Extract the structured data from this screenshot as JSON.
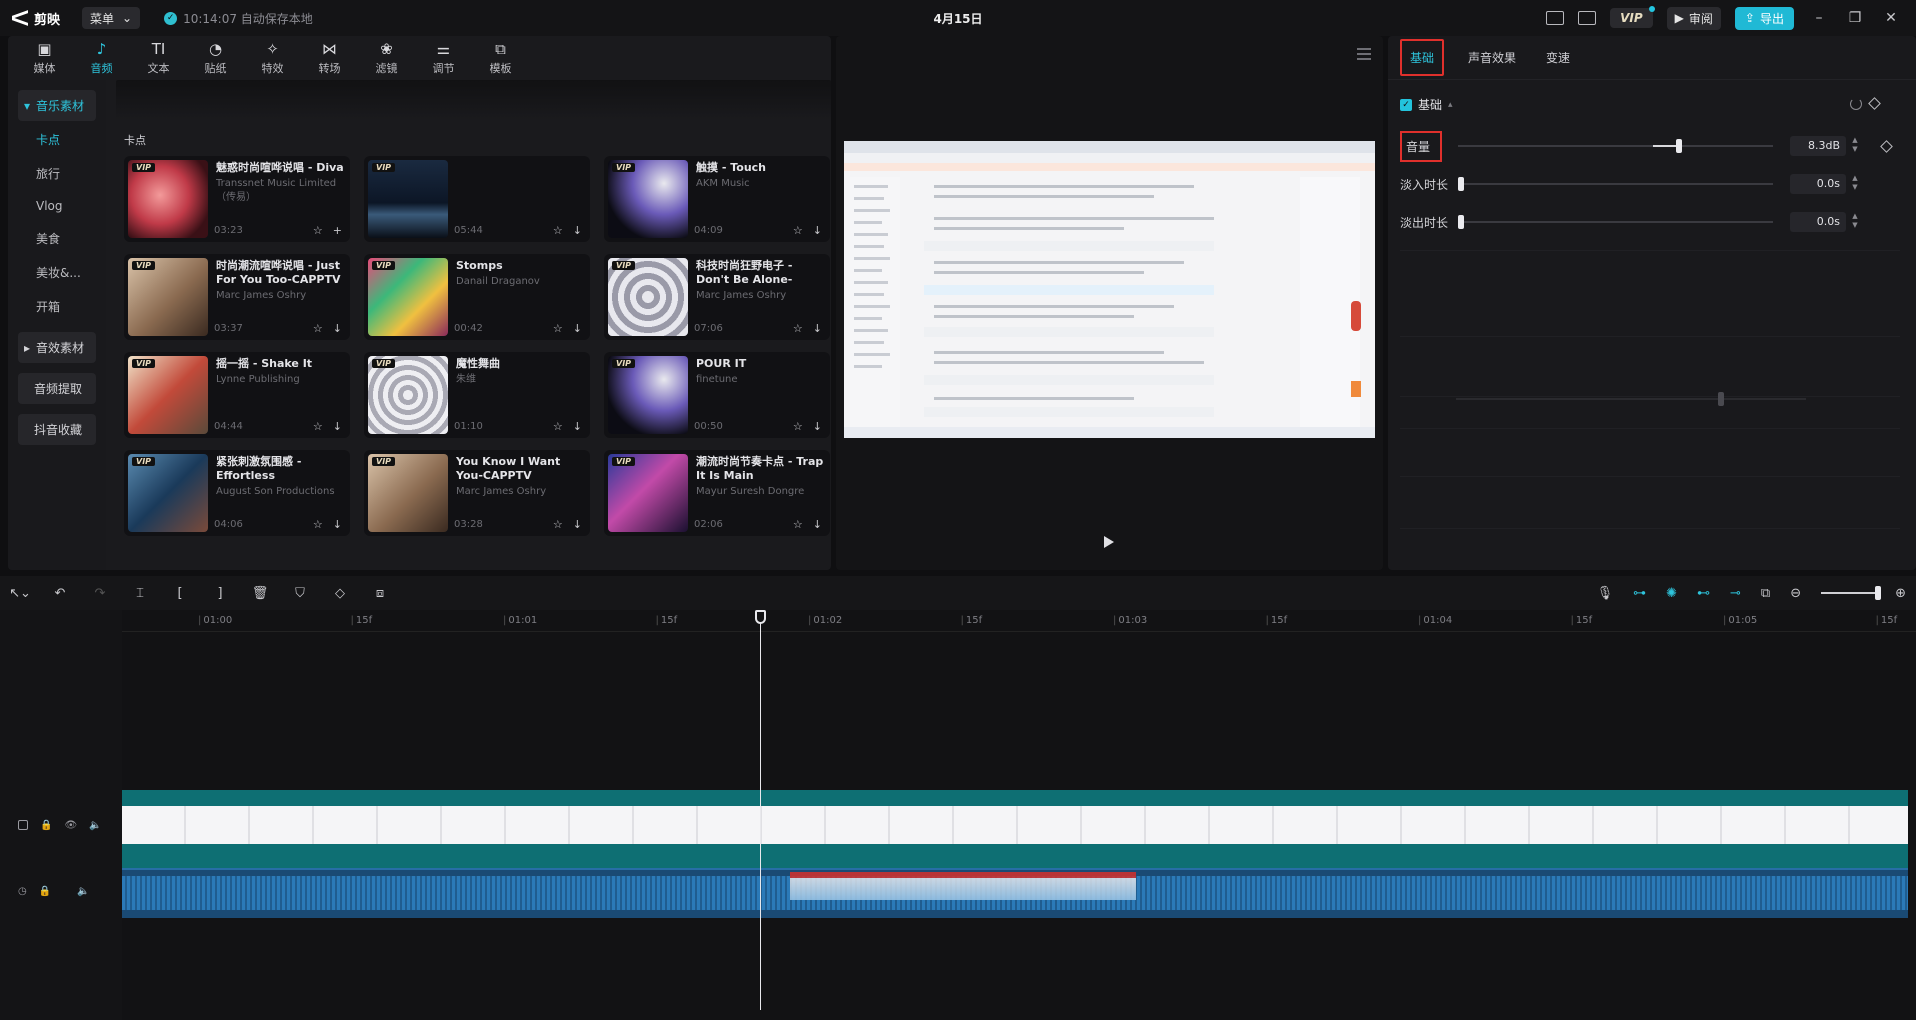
{
  "titlebar": {
    "app_name": "剪映",
    "menu_label": "菜单",
    "save_status": "10:14:07 自动保存本地",
    "project_title": "4月15日",
    "vip_label": "VIP",
    "review_label": "审阅",
    "export_label": "导出"
  },
  "toolbar": {
    "tabs": [
      {
        "label": "媒体",
        "icon": "media-icon",
        "glyph": "▣"
      },
      {
        "label": "音频",
        "icon": "audio-icon",
        "glyph": "♪"
      },
      {
        "label": "文本",
        "icon": "text-icon",
        "glyph": "TI"
      },
      {
        "label": "贴纸",
        "icon": "sticker-icon",
        "glyph": "◔"
      },
      {
        "label": "特效",
        "icon": "effects-icon",
        "glyph": "✧"
      },
      {
        "label": "转场",
        "icon": "transition-icon",
        "glyph": "⋈"
      },
      {
        "label": "滤镜",
        "icon": "filter-icon",
        "glyph": "❀"
      },
      {
        "label": "调节",
        "icon": "adjust-icon",
        "glyph": "⚌"
      },
      {
        "label": "模板",
        "icon": "template-icon",
        "glyph": "⧉"
      }
    ],
    "active_index": 1
  },
  "sidebar": {
    "music_header": "音乐素材",
    "items": [
      "卡点",
      "旅行",
      "Vlog",
      "美食",
      "美妆&...",
      "开箱"
    ],
    "active_index": 0,
    "sfx_header": "音效素材",
    "extract_label": "音频提取",
    "douyin_label": "抖音收藏"
  },
  "section_label": "卡点",
  "music": [
    {
      "title": "魅惑时尚喧哗说唱 - Diva",
      "artist": "Transsnet Music Limited（传易）",
      "duration": "03:23",
      "action": "+"
    },
    {
      "title": "",
      "artist": "",
      "duration": "05:44",
      "action": "↓"
    },
    {
      "title": "触摸 - Touch",
      "artist": "AKM Music",
      "duration": "04:09",
      "action": "↓"
    },
    {
      "title": "时尚潮流喧哗说唱 - Just For You Too-CAPPTV",
      "artist": "Marc James Oshry",
      "duration": "03:37",
      "action": "↓"
    },
    {
      "title": "Stomps",
      "artist": "Danail Draganov",
      "duration": "00:42",
      "action": "↓"
    },
    {
      "title": "科技时尚狂野电子 - Don't Be Alone-CAPPVF",
      "artist": "Marc James Oshry",
      "duration": "07:06",
      "action": "↓"
    },
    {
      "title": "摇一摇 - Shake It",
      "artist": "Lynne Publishing",
      "duration": "04:44",
      "action": "↓"
    },
    {
      "title": "魔性舞曲",
      "artist": "朱维",
      "duration": "01:10",
      "action": "↓"
    },
    {
      "title": "POUR IT",
      "artist": "finetune",
      "duration": "00:50",
      "action": "↓"
    },
    {
      "title": "紧张刺激氛围感 - Effortless",
      "artist": "August Son Productions",
      "duration": "04:06",
      "action": "↓"
    },
    {
      "title": "You Know I Want You-CAPPTV",
      "artist": "Marc James Oshry",
      "duration": "03:28",
      "action": "↓"
    },
    {
      "title": "潮流时尚节奏卡点 - Trap It Is Main",
      "artist": "Mayur Suresh Dongre",
      "duration": "02:06",
      "action": "↓"
    }
  ],
  "props": {
    "tabs": [
      "基础",
      "声音效果",
      "变速"
    ],
    "active_tab": 0,
    "section_title": "基础",
    "volume_label": "音量",
    "volume_value": "8.3dB",
    "volume_level": 0.7,
    "fade_in_label": "淡入时长",
    "fade_in_value": "0.0s",
    "fade_out_label": "淡出时长",
    "fade_out_value": "0.0s"
  },
  "timeline": {
    "ticks": [
      "01:00",
      "15f",
      "01:01",
      "15f",
      "01:02",
      "15f",
      "01:03",
      "15f",
      "01:04",
      "15f",
      "01:05",
      "15f"
    ]
  },
  "colors": {
    "accent": "#2ec4dc",
    "highlight": "#e0302c",
    "video_track": "#0e6f73",
    "audio_track": "#1a4a74"
  }
}
